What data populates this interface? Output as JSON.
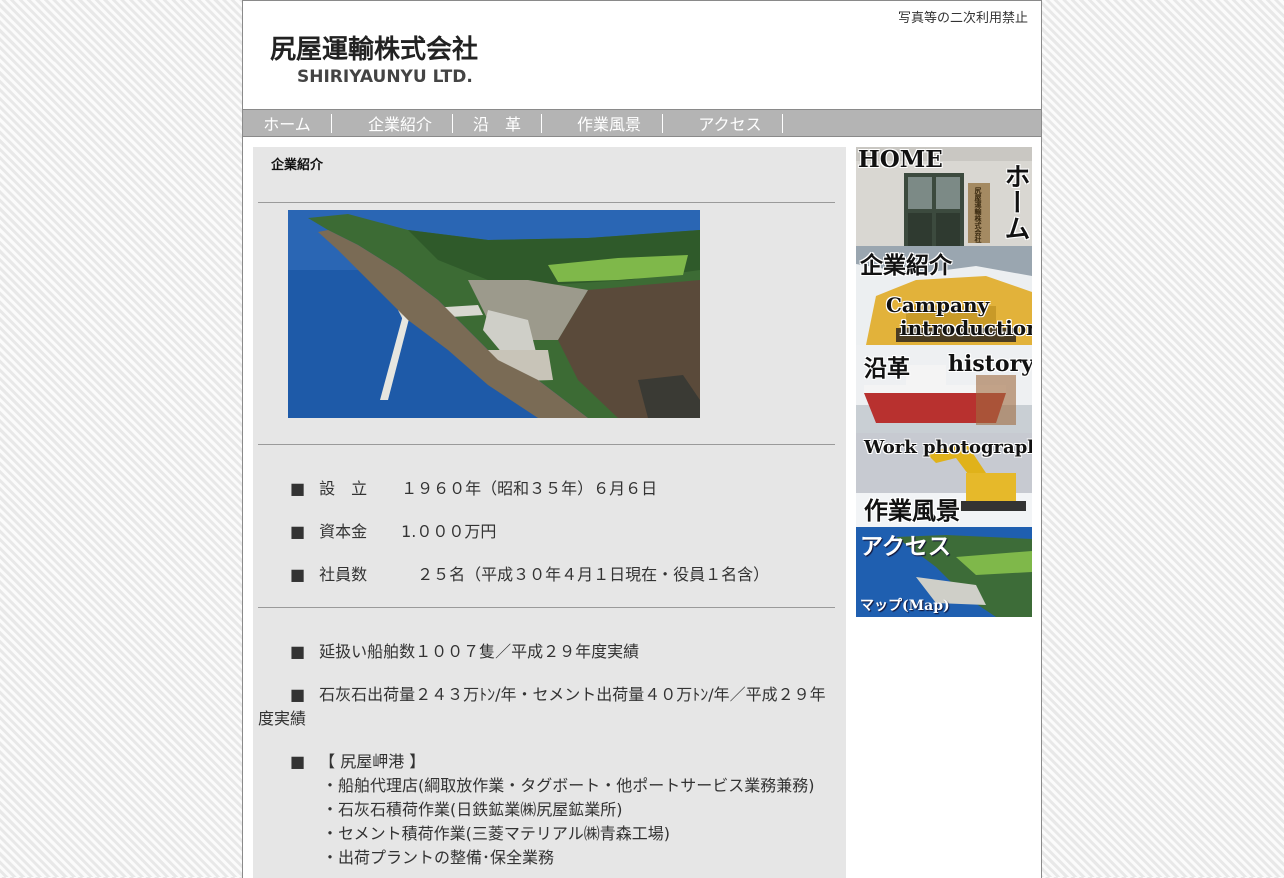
{
  "header": {
    "notice": "写真等の二次利用禁止",
    "company_name": "尻屋運輸株式会社",
    "company_name_en": "SHIRIYAUNYU LTD."
  },
  "nav": {
    "items": [
      {
        "label": "ホーム"
      },
      {
        "label": "企業紹介"
      },
      {
        "label": "沿　革"
      },
      {
        "label": "作業風景"
      },
      {
        "label": "アクセス"
      }
    ]
  },
  "main": {
    "section_title": "企業紹介",
    "info1": [
      {
        "label": "設　立",
        "value": "１９６０年（昭和３５年）６月６日"
      },
      {
        "label": "資本金",
        "value": "1.０００万円"
      },
      {
        "label": "社員数",
        "value": "２５名（平成３０年４月１日現在・役員１名含）"
      }
    ],
    "info2": {
      "ships": "延扱い船舶数１００７隻／平成２９年度実績",
      "shipment_line1": "石灰石出荷量２４３万ﾄﾝ/年・セメント出荷量４０万ﾄﾝ/年／平成２９年",
      "shipment_line2": "度実績",
      "port_title": "【 尻屋岬港 】",
      "port_items": [
        "・船舶代理店(綱取放作業・タグボート・他ポートサービス業務兼務)",
        "・石灰石積荷作業(日鉄鉱業㈱尻屋鉱業所)",
        "・セメント積荷作業(三菱マテリアル㈱青森工場)",
        "・出荷プラントの整備･保全業務"
      ]
    },
    "bullet": "■"
  },
  "sidebar": {
    "home": {
      "en": "HOME",
      "jp": "ホーム",
      "sign": "尻屋運輸株式会社"
    },
    "company": {
      "jp": "企業紹介",
      "en1": "Campany",
      "en2": "introduction"
    },
    "history": {
      "jp": "沿革",
      "en": "history"
    },
    "work": {
      "en": "Work photograph",
      "jp": "作業風景"
    },
    "access": {
      "jp": "アクセス",
      "en": "マップ(Map)"
    }
  }
}
